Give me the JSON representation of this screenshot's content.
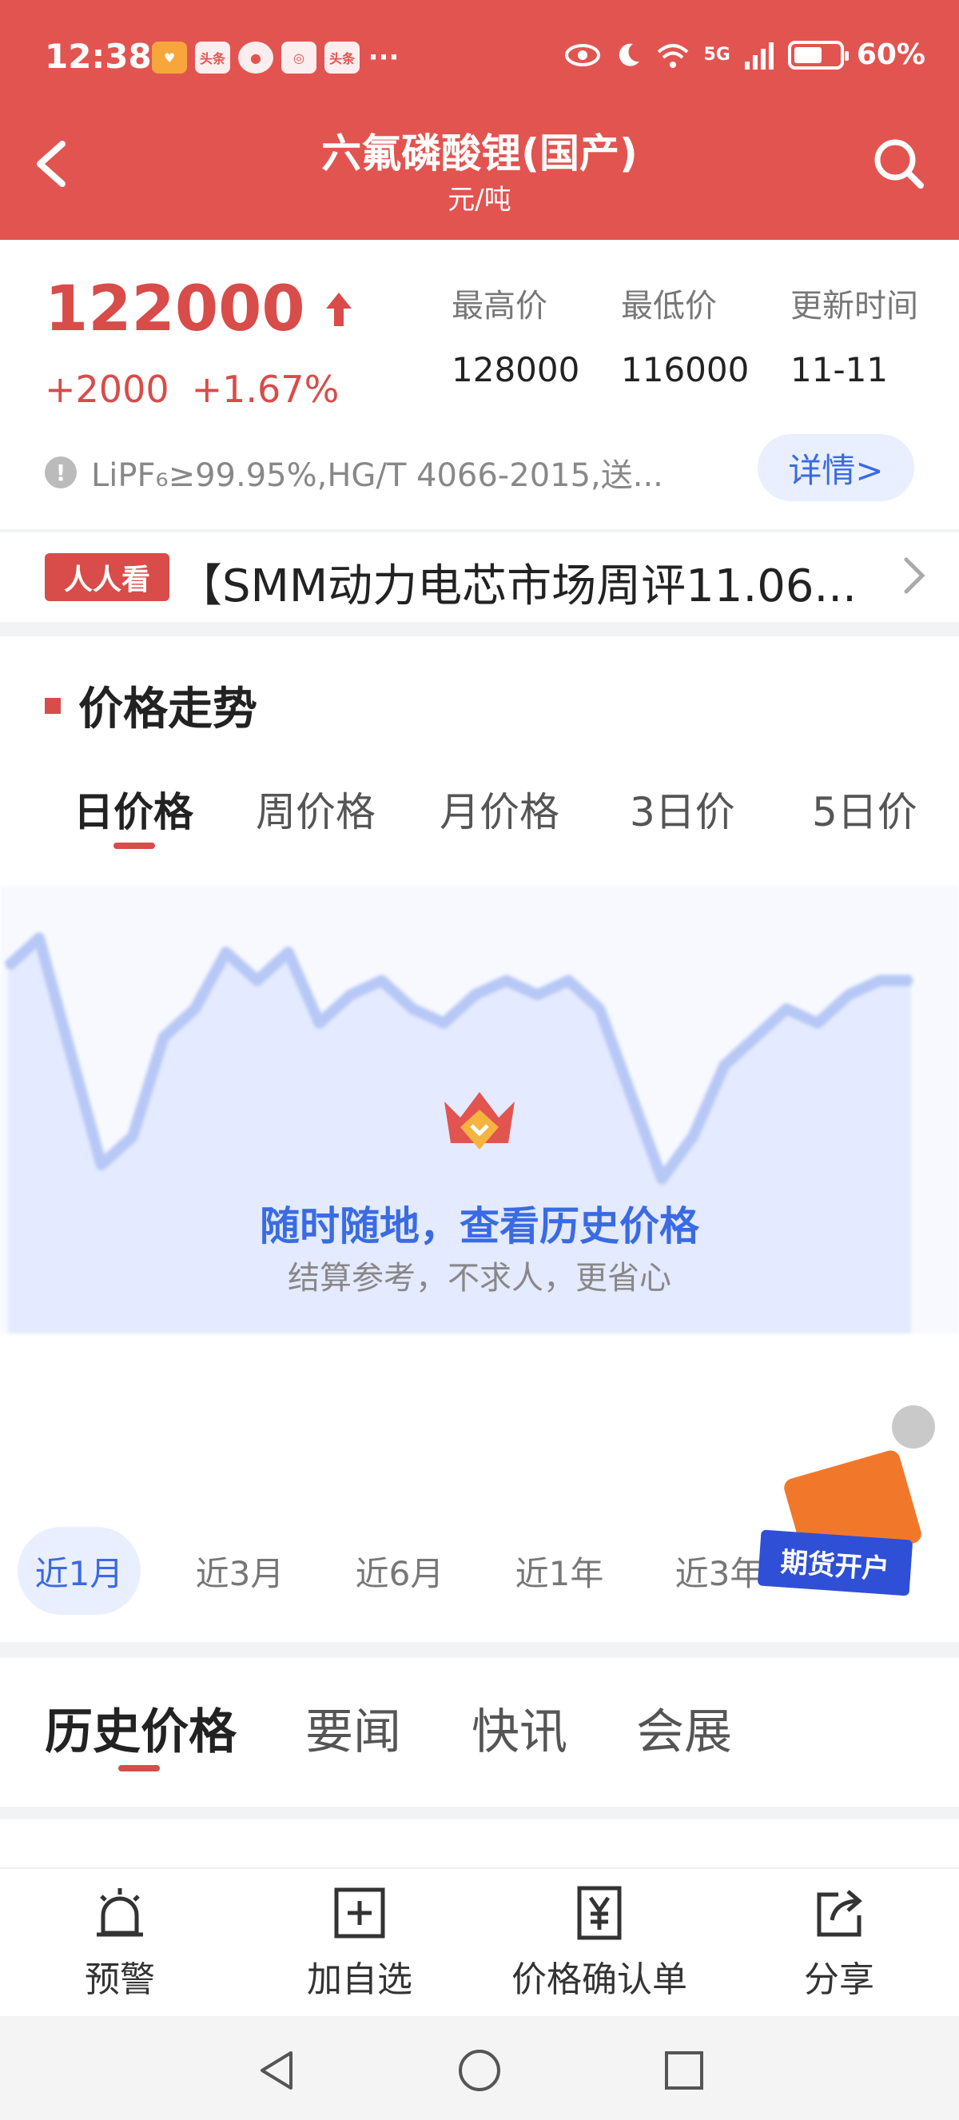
{
  "status_bar": {
    "time": "12:38",
    "notif_icons": [
      "heart-app-icon",
      "toutiao-icon",
      "message-icon",
      "app-icon",
      "toutiao-icon"
    ],
    "notif_labels": [
      "",
      "头条",
      "",
      "",
      "头条"
    ],
    "more": "···",
    "signal_label": "5G",
    "battery": "60%"
  },
  "header": {
    "title": "六氟磷酸锂(国产)",
    "unit": "元/吨",
    "bg_color": "#e25450"
  },
  "price": {
    "current": "122000",
    "change": "+2000",
    "change_pct": "+1.67%",
    "stats": [
      {
        "label": "最高价",
        "value": "128000"
      },
      {
        "label": "最低价",
        "value": "116000"
      },
      {
        "label": "更新时间",
        "value": "11-11"
      }
    ],
    "spec": "LiPF₆≥99.95%,HG/T 4066-2015,送...",
    "detail_btn": "详情>"
  },
  "news": {
    "tag": "人人看",
    "text": "【SMM动力电芯市场周评11.06..."
  },
  "trend": {
    "title": "价格走势",
    "period_tabs": [
      "日价格",
      "周价格",
      "月价格",
      "3日价",
      "5日价"
    ],
    "active_period": 0,
    "overlay_line1": "随时随地，查看历史价格",
    "overlay_line2": "结算参考，不求人，更省心",
    "range_tabs": [
      "近1月",
      "近3月",
      "近6月",
      "近1年",
      "近3年"
    ],
    "active_range": 0,
    "futures_badge": "期货开户"
  },
  "history_tabs": [
    "历史价格",
    "要闻",
    "快讯",
    "会展"
  ],
  "active_history_tab": 0,
  "bottom_actions": [
    {
      "label": "预警",
      "icon": "alarm-icon"
    },
    {
      "label": "加自选",
      "icon": "add-box-icon"
    },
    {
      "label": "价格确认单",
      "icon": "yen-document-icon"
    },
    {
      "label": "分享",
      "icon": "share-icon"
    }
  ],
  "chart_data": {
    "type": "area",
    "note_visible": "blurred preview",
    "series": [
      {
        "values": [
          118,
          120,
          112,
          104,
          106,
          113,
          115,
          119,
          117,
          119,
          114,
          116,
          117,
          115,
          114,
          116,
          117,
          116,
          117,
          115,
          109,
          103,
          106,
          111,
          113,
          115,
          114,
          116,
          117,
          117
        ]
      }
    ],
    "ylim": [
      100,
      122
    ]
  }
}
